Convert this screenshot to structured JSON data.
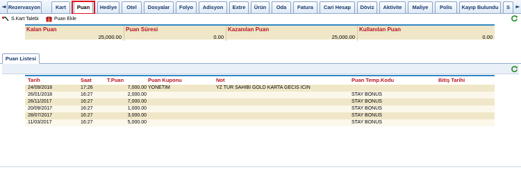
{
  "top_tabs": [
    "Rezervasyon",
    "Kart",
    "Puan",
    "Hediye",
    "Otel",
    "Dosyalar",
    "Folyo",
    "Adisyon",
    "Extre",
    "Ürün",
    "Oda",
    "Fatura",
    "Cari Hesap",
    "Döviz",
    "Aktivite",
    "Maliye",
    "Polis",
    "Kayıp Bulundu",
    "S"
  ],
  "active_tab": "Puan",
  "toolbar": {
    "kart_talebi": "S.Kart Talebi",
    "puan_ekle": "Puan Ekle"
  },
  "summary": {
    "headers": [
      "Kalan Puan",
      "Puan Süresi",
      "Kazanılan Puan",
      "Kullanılan Puan"
    ],
    "values": [
      "25,000.00",
      "0.00",
      "25,000.00",
      "0.00"
    ]
  },
  "section_tab": "Puan Listesi",
  "list": {
    "columns": [
      "Tarih",
      "Saat",
      "T.Puan",
      "Puan Kuponu",
      "Not",
      "Puan Temp.Kodu",
      "Bitiş Tarihi"
    ],
    "rows": [
      [
        "24/09/2018",
        "17:26",
        "7,000.00",
        "YONETIM",
        "YZ TUR SAHIBI GOLD KARTA GECIS ICIN",
        "",
        ""
      ],
      [
        "26/01/2018",
        "16:27",
        "2,000.00",
        "",
        "",
        "STAY BONUS",
        ""
      ],
      [
        "26/11/2017",
        "16:27",
        "7,000.00",
        "",
        "",
        "STAY BONUS",
        ""
      ],
      [
        "20/09/2017",
        "16:27",
        "1,000.00",
        "",
        "",
        "STAY BONUS",
        ""
      ],
      [
        "28/07/2017",
        "16:27",
        "3,000.00",
        "",
        "",
        "STAY BONUS",
        ""
      ],
      [
        "11/03/2017",
        "16:27",
        "5,000.00",
        "",
        "",
        "STAY BONUS",
        ""
      ]
    ]
  },
  "icons": {
    "nav_left": "arrow-left-icon",
    "nav_right": "arrow-right-icon",
    "refresh": "refresh-icon",
    "card_request": "card-icon",
    "gift": "gift-icon"
  },
  "colors": {
    "header_text": "#b8121d",
    "frame_accent": "#2f86c4",
    "row_odd": "#efe7c8",
    "row_even": "#fbf7ea",
    "active_tab_outline": "#e2141b"
  }
}
